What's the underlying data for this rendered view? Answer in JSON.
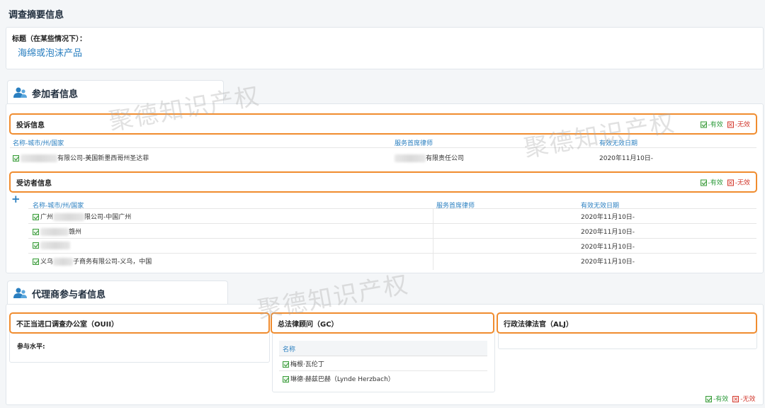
{
  "page": {
    "title": "调查摘要信息"
  },
  "summary": {
    "title_label": "标题（在某些情况下）：",
    "title_value": "海绵或泡沫产品"
  },
  "participants": {
    "section_title": "参加者信息",
    "complainant": {
      "header": "投诉信息",
      "legend_valid": "-有效",
      "legend_invalid": "-无效",
      "columns": [
        "名称-城市/州/国家",
        "服务首席律师",
        "有效无效日期"
      ],
      "rows": [
        {
          "name": "有限公司-美国新墨西哥州圣达菲",
          "counsel": "有限责任公司",
          "date": "2020年11月10日-"
        }
      ]
    },
    "respondent": {
      "header": "受访者信息",
      "legend_valid": "-有效",
      "legend_invalid": "-无效",
      "columns": [
        "名称-城市/州/国家",
        "服务首席律师",
        "有效无效日期"
      ],
      "rows": [
        {
          "name_prefix": "广州",
          "name": "限公司-中国广州",
          "date": "2020年11月10日-"
        },
        {
          "name_prefix": "",
          "name": "赣州",
          "date": "2020年11月10日-"
        },
        {
          "name_prefix": "",
          "name": "",
          "date": "2020年11月10日-"
        },
        {
          "name_prefix": "义乌",
          "name": "子商务有限公司-义乌，中国",
          "date": "2020年11月10日-"
        }
      ]
    }
  },
  "agency": {
    "section_title": "代理商参与者信息",
    "ouii": {
      "header": "不正当进口调查办公室（OUII）",
      "level_label": "参与水平:"
    },
    "gc": {
      "header": "总法律顾问（GC）",
      "column": "名称",
      "rows": [
        "梅根·瓦伦丁",
        "琳德·赫兹巴赫（Lynde Herzbach）"
      ]
    },
    "alj": {
      "header": "行政法律法官（ALJ）"
    },
    "legend_valid": "-有效",
    "legend_invalid": "-无效"
  },
  "watermark": "聚德知识产权"
}
